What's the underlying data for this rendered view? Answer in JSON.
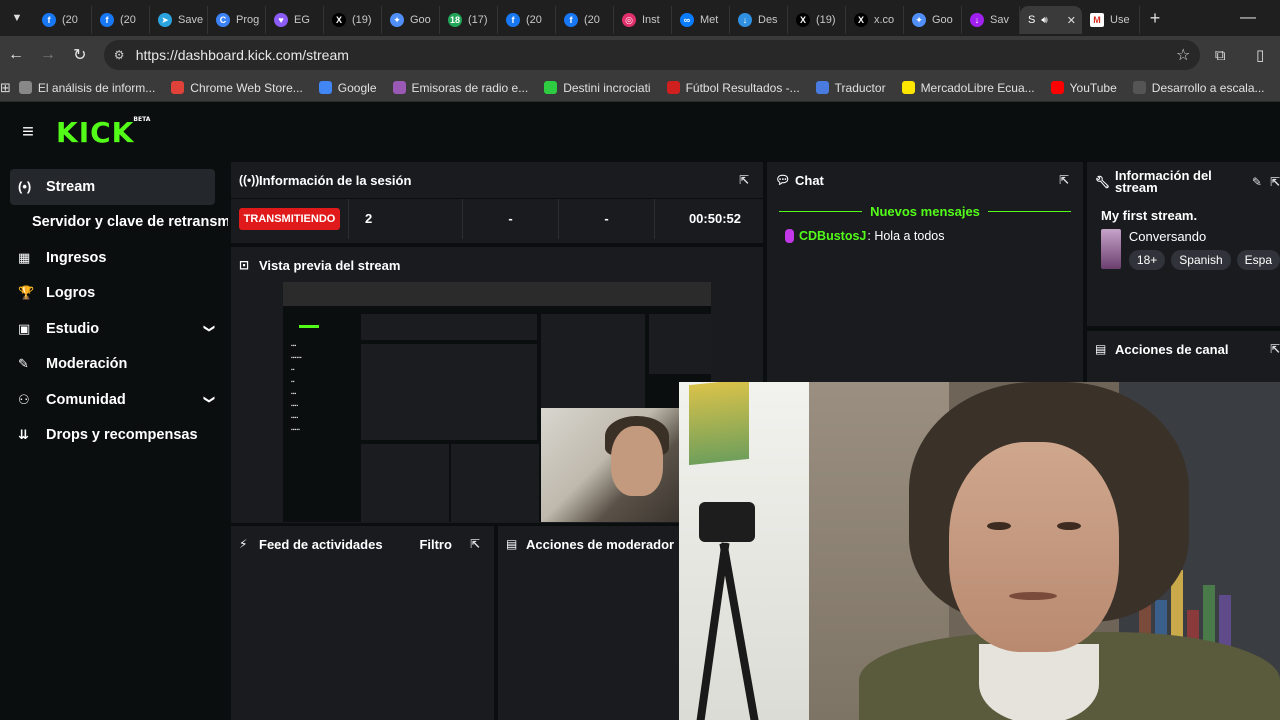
{
  "browser": {
    "tabs": [
      {
        "title": "(20",
        "icon": "facebook-icon",
        "color": "#1877f2",
        "glyph": "f"
      },
      {
        "title": "(20",
        "icon": "facebook-icon",
        "color": "#1877f2",
        "glyph": "f"
      },
      {
        "title": "Save",
        "icon": "telegram-icon",
        "color": "#2aa3df",
        "glyph": "➤"
      },
      {
        "title": "Prog",
        "icon": "c-logo-icon",
        "color": "#3b82f6",
        "glyph": "C"
      },
      {
        "title": "EG",
        "icon": "heart-shield-icon",
        "color": "#8b5cf6",
        "glyph": "♥"
      },
      {
        "title": "(19)",
        "icon": "x-logo-icon",
        "color": "#000000",
        "glyph": "X"
      },
      {
        "title": "Goo",
        "icon": "gemini-icon",
        "color": "#4f8ff7",
        "glyph": "✦"
      },
      {
        "title": "(17)",
        "icon": "green-badge-icon",
        "color": "#22a559",
        "glyph": "18"
      },
      {
        "title": "(20",
        "icon": "facebook-icon",
        "color": "#1877f2",
        "glyph": "f"
      },
      {
        "title": "(20",
        "icon": "facebook-icon",
        "color": "#1877f2",
        "glyph": "f"
      },
      {
        "title": "Inst",
        "icon": "instagram-icon",
        "color": "#e1306c",
        "glyph": "◎"
      },
      {
        "title": "Met",
        "icon": "meta-icon",
        "color": "#0a7cff",
        "glyph": "∞"
      },
      {
        "title": "Des",
        "icon": "download-icon",
        "color": "#2f8fe0",
        "glyph": "↓"
      },
      {
        "title": "(19)",
        "icon": "x-logo-icon",
        "color": "#000000",
        "glyph": "X"
      },
      {
        "title": "x.co",
        "icon": "x-logo-icon",
        "color": "#000000",
        "glyph": "X"
      },
      {
        "title": "Goo",
        "icon": "gemini-icon",
        "color": "#4f8ff7",
        "glyph": "✦"
      },
      {
        "title": "Sav",
        "icon": "save-purple-icon",
        "color": "#a020f0",
        "glyph": "↓"
      }
    ],
    "active_tab": {
      "title": "S",
      "icon": "speaker-icon"
    },
    "extra_tab": {
      "title": "Use",
      "icon": "gmail-icon"
    },
    "url": "https://dashboard.kick.com/stream",
    "bookmarks": [
      {
        "label": "El análisis de inform...",
        "color": "#888888"
      },
      {
        "label": "Chrome Web Store...",
        "color": "#e0423a"
      },
      {
        "label": "Google",
        "color": "#4285f4"
      },
      {
        "label": "Emisoras de radio e...",
        "color": "#9b59b6"
      },
      {
        "label": "Destini incrociati",
        "color": "#2ecc40"
      },
      {
        "label": "Fútbol Resultados -...",
        "color": "#d01f1f"
      },
      {
        "label": "Traductor",
        "color": "#4a7be0"
      },
      {
        "label": "MercadoLibre Ecua...",
        "color": "#ffe600"
      },
      {
        "label": "YouTube",
        "color": "#ff0000"
      },
      {
        "label": "Desarrollo a escala...",
        "color": "#555555"
      }
    ],
    "bookmarks_more": "»"
  },
  "kick": {
    "logo": "KICK",
    "logo_badge": "BETA",
    "accent": "#53fc18",
    "sidebar": [
      {
        "label": "Stream",
        "icon": "broadcast-icon",
        "glyph": "(•)",
        "active": true,
        "sub": false,
        "chevron": false
      },
      {
        "label": "Servidor y clave de retransmisión",
        "icon": "",
        "glyph": "",
        "active": false,
        "sub": true,
        "chevron": false
      },
      {
        "label": "Ingresos",
        "icon": "revenue-icon",
        "glyph": "▦",
        "active": false,
        "sub": false,
        "chevron": false
      },
      {
        "label": "Logros",
        "icon": "trophy-icon",
        "glyph": "🏆",
        "active": false,
        "sub": false,
        "chevron": false
      },
      {
        "label": "Estudio",
        "icon": "studio-icon",
        "glyph": "▣",
        "active": false,
        "sub": false,
        "chevron": true
      },
      {
        "label": "Moderación",
        "icon": "wrench-icon",
        "glyph": "✎",
        "active": false,
        "sub": false,
        "chevron": false
      },
      {
        "label": "Comunidad",
        "icon": "community-icon",
        "glyph": "⚇",
        "active": false,
        "sub": false,
        "chevron": true
      },
      {
        "label": "Drops y recompensas",
        "icon": "drops-icon",
        "glyph": "⇊",
        "active": false,
        "sub": false,
        "chevron": false
      }
    ],
    "session": {
      "title": "Información de la sesión",
      "status": "TRANSMITIENDO",
      "viewers": "2",
      "stat2": "-",
      "stat3": "-",
      "uptime": "00:50:52"
    },
    "preview": {
      "title": "Vista previa del stream"
    },
    "chat": {
      "title": "Chat",
      "divider": "Nuevos mensajes",
      "messages": [
        {
          "user": "CDBustosJ",
          "text": ": Hola a todos"
        }
      ]
    },
    "info": {
      "title": "Información del stream",
      "stream_title": "My first stream.",
      "category": "Conversando",
      "tags": [
        "18+",
        "Spanish",
        "Espa"
      ]
    },
    "channel_actions": {
      "title": "Acciones de canal"
    },
    "activity": {
      "title": "Feed de actividades",
      "filter": "Filtro"
    },
    "mod_actions": {
      "title": "Acciones de moderador"
    }
  }
}
